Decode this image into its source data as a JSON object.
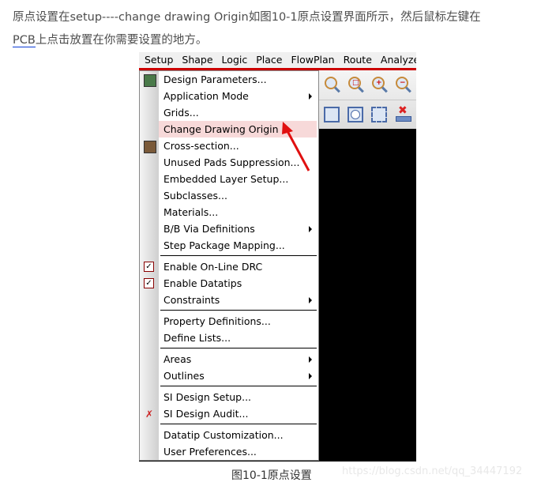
{
  "article": {
    "line1_text": "原点设置在setup----change drawing Origin如图10-1原点设置界面所示，然后鼠标左键在",
    "link_text": "PCB",
    "line2_rest": "上点击放置在你需要设置的地方。",
    "caption": "图10-1原点设置",
    "watermark": "https://blog.csdn.net/qq_34447192"
  },
  "menubar": [
    "Setup",
    "Shape",
    "Logic",
    "Place",
    "FlowPlan",
    "Route",
    "Analyze"
  ],
  "menu": {
    "items": [
      {
        "label": "Design Parameters...",
        "icon": "design-parameters-icon"
      },
      {
        "label": "Application Mode",
        "submenu": true
      },
      {
        "label": "Grids..."
      },
      {
        "label": "Change Drawing Origin",
        "highlighted": true
      },
      {
        "label": "Cross-section...",
        "icon": "cross-section-icon"
      },
      {
        "label": "Unused Pads Suppression..."
      },
      {
        "label": "Embedded Layer Setup..."
      },
      {
        "label": "Subclasses..."
      },
      {
        "label": "Materials..."
      },
      {
        "label": "B/B Via Definitions",
        "submenu": true
      },
      {
        "label": "Step Package Mapping..."
      },
      {
        "label": "Enable On-Line DRC",
        "checked": true
      },
      {
        "label": "Enable Datatips",
        "checked": true
      },
      {
        "label": "Constraints",
        "submenu": true
      },
      {
        "label": "Property Definitions..."
      },
      {
        "label": "Define Lists..."
      },
      {
        "label": "Areas",
        "submenu": true
      },
      {
        "label": "Outlines",
        "submenu": true
      },
      {
        "label": "SI Design Setup..."
      },
      {
        "label": "SI Design Audit...",
        "icon": "si-audit-icon"
      },
      {
        "label": "Datatip Customization..."
      },
      {
        "label": "User Preferences..."
      }
    ]
  },
  "colors": {
    "highlight": "#f7d9d9",
    "accent_red": "#cc0000",
    "link_underline": "#0c3cd6"
  }
}
